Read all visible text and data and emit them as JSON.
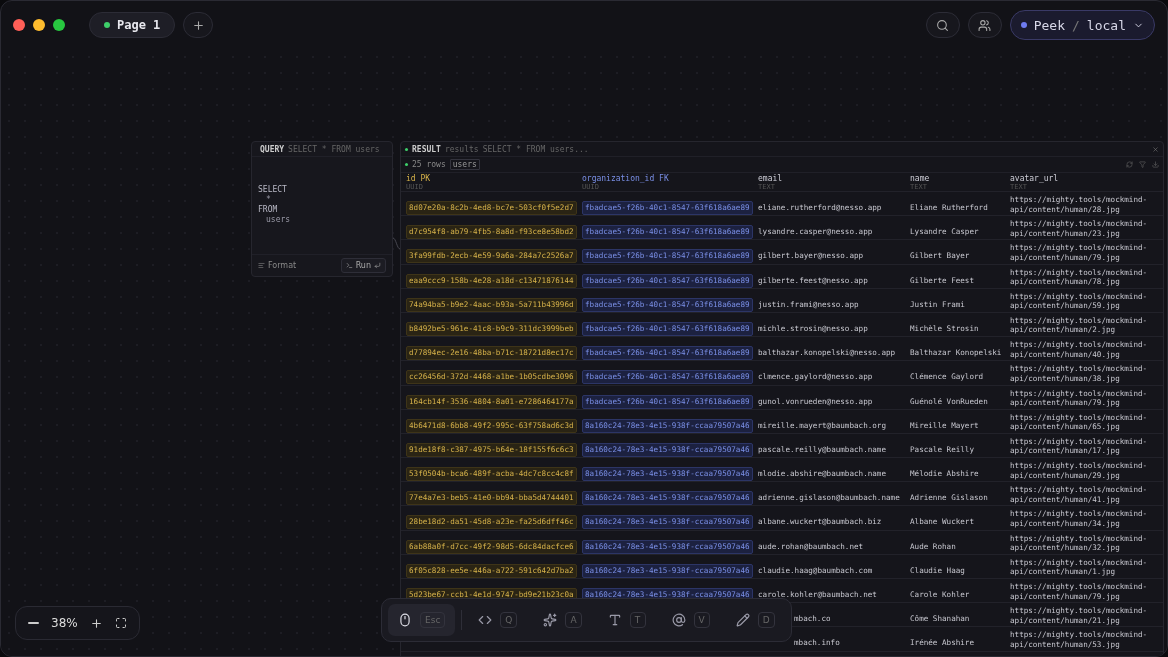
{
  "window": {
    "tabs": [
      {
        "label": "Page 1",
        "selected": true
      }
    ],
    "workspace": {
      "name": "Peek",
      "separator": "/",
      "env": "local"
    }
  },
  "query": {
    "title": "QUERY",
    "subtitle": "SELECT * FROM users",
    "sql": [
      {
        "kind": "keyword",
        "text": "SELECT"
      },
      {
        "kind": "value",
        "text": "*"
      },
      {
        "kind": "keyword",
        "text": "FROM"
      },
      {
        "kind": "value",
        "text": "users"
      }
    ],
    "format_label": "Format",
    "run_label": "Run"
  },
  "result": {
    "title": "RESULT",
    "source": "results",
    "query": "SELECT * FROM users...",
    "row_count": "25 rows",
    "table_tag": "users",
    "columns": [
      {
        "kind": "pk",
        "name": "id",
        "key": "PK",
        "type": "UUID"
      },
      {
        "kind": "fk",
        "name": "organization_id",
        "key": "FK",
        "type": "UUID"
      },
      {
        "kind": "text",
        "name": "email",
        "type": "TEXT"
      },
      {
        "kind": "text",
        "name": "name",
        "type": "TEXT"
      },
      {
        "kind": "text",
        "name": "avatar_url",
        "type": "TEXT"
      }
    ],
    "rows": [
      {
        "id": "8d07e20a-8c2b-4ed8-bc7e-503cf0f5e2d7",
        "organization_id": "fbadcae5-f26b-40c1-8547-63f618a6ae89",
        "email": "eliane.rutherford@nesso.app",
        "name": "Eliane Rutherford",
        "avatar_url": "https://mighty.tools/mockmind-api/content/human/28.jpg"
      },
      {
        "id": "d7c954f8-ab79-4fb5-8a8d-f93ce8e58bd2",
        "organization_id": "fbadcae5-f26b-40c1-8547-63f618a6ae89",
        "email": "lysandre.casper@nesso.app",
        "name": "Lysandre Casper",
        "avatar_url": "https://mighty.tools/mockmind-api/content/human/23.jpg"
      },
      {
        "id": "3fa99fdb-2ecb-4e59-9a6a-284a7c2526a7",
        "organization_id": "fbadcae5-f26b-40c1-8547-63f618a6ae89",
        "email": "gilbert.bayer@nesso.app",
        "name": "Gilbert Bayer",
        "avatar_url": "https://mighty.tools/mockmind-api/content/human/79.jpg"
      },
      {
        "id": "eaa9ccc9-158b-4e28-a18d-c13471876144",
        "organization_id": "fbadcae5-f26b-40c1-8547-63f618a6ae89",
        "email": "gilberte.feest@nesso.app",
        "name": "Gilberte Feest",
        "avatar_url": "https://mighty.tools/mockmind-api/content/human/78.jpg"
      },
      {
        "id": "74a94ba5-b9e2-4aac-b93a-5a711b43996d",
        "organization_id": "fbadcae5-f26b-40c1-8547-63f618a6ae89",
        "email": "justin.frami@nesso.app",
        "name": "Justin Frami",
        "avatar_url": "https://mighty.tools/mockmind-api/content/human/59.jpg"
      },
      {
        "id": "b8492be5-961e-41c8-b9c9-311dc3999beb",
        "organization_id": "fbadcae5-f26b-40c1-8547-63f618a6ae89",
        "email": "michle.strosin@nesso.app",
        "name": "Michèle Strosin",
        "avatar_url": "https://mighty.tools/mockmind-api/content/human/2.jpg"
      },
      {
        "id": "d77894ec-2e16-48ba-b71c-18721d8ec17c",
        "organization_id": "fbadcae5-f26b-40c1-8547-63f618a6ae89",
        "email": "balthazar.konopelski@nesso.app",
        "name": "Balthazar Konopelski",
        "avatar_url": "https://mighty.tools/mockmind-api/content/human/40.jpg"
      },
      {
        "id": "cc26456d-372d-4468-a1be-1b05cdbe3096",
        "organization_id": "fbadcae5-f26b-40c1-8547-63f618a6ae89",
        "email": "clmence.gaylord@nesso.app",
        "name": "Clémence Gaylord",
        "avatar_url": "https://mighty.tools/mockmind-api/content/human/38.jpg"
      },
      {
        "id": "164cb14f-3536-4804-8a01-e7286464177a",
        "organization_id": "fbadcae5-f26b-40c1-8547-63f618a6ae89",
        "email": "gunol.vonrueden@nesso.app",
        "name": "Guénolé VonRueden",
        "avatar_url": "https://mighty.tools/mockmind-api/content/human/79.jpg"
      },
      {
        "id": "4b6471d8-6bb8-49f2-995c-63f758ad6c3d",
        "organization_id": "8a160c24-78e3-4e15-938f-ccaa79507a46",
        "email": "mireille.mayert@baumbach.org",
        "name": "Mireille Mayert",
        "avatar_url": "https://mighty.tools/mockmind-api/content/human/65.jpg"
      },
      {
        "id": "91de18f8-c387-4975-b64e-18f155f6c6c3",
        "organization_id": "8a160c24-78e3-4e15-938f-ccaa79507a46",
        "email": "pascale.reilly@baumbach.name",
        "name": "Pascale Reilly",
        "avatar_url": "https://mighty.tools/mockmind-api/content/human/17.jpg"
      },
      {
        "id": "53f0504b-bca6-489f-acba-4dc7c8cc4c8f",
        "organization_id": "8a160c24-78e3-4e15-938f-ccaa79507a46",
        "email": "mlodie.abshire@baumbach.name",
        "name": "Mélodie Abshire",
        "avatar_url": "https://mighty.tools/mockmind-api/content/human/29.jpg"
      },
      {
        "id": "77e4a7e3-beb5-41e0-bb94-bba5d4744401",
        "organization_id": "8a160c24-78e3-4e15-938f-ccaa79507a46",
        "email": "adrienne.gislason@baumbach.name",
        "name": "Adrienne Gislason",
        "avatar_url": "https://mighty.tools/mockmind-api/content/human/41.jpg"
      },
      {
        "id": "28be18d2-da51-45d8-a23e-fa25d6dff46c",
        "organization_id": "8a160c24-78e3-4e15-938f-ccaa79507a46",
        "email": "albane.wuckert@baumbach.biz",
        "name": "Albane Wuckert",
        "avatar_url": "https://mighty.tools/mockmind-api/content/human/34.jpg"
      },
      {
        "id": "6ab88a0f-d7cc-49f2-98d5-6dc84dacfce6",
        "organization_id": "8a160c24-78e3-4e15-938f-ccaa79507a46",
        "email": "aude.rohan@baumbach.net",
        "name": "Aude Rohan",
        "avatar_url": "https://mighty.tools/mockmind-api/content/human/32.jpg"
      },
      {
        "id": "6f05c828-ee5e-446a-a722-591c642d7ba2",
        "organization_id": "8a160c24-78e3-4e15-938f-ccaa79507a46",
        "email": "claudie.haag@baumbach.com",
        "name": "Claudie Haag",
        "avatar_url": "https://mighty.tools/mockmind-api/content/human/1.jpg"
      },
      {
        "id": "5d23be67-ccb1-4e1d-9747-bd9e21b23c0a",
        "organization_id": "8a160c24-78e3-4e15-938f-ccaa79507a46",
        "email": "carole.kohler@baumbach.net",
        "name": "Carole Kohler",
        "avatar_url": "https://mighty.tools/mockmind-api/content/human/79.jpg"
      },
      {
        "email": "mbach.co",
        "name": "Côme Shanahan",
        "avatar_url": "https://mighty.tools/mockmind-api/content/human/21.jpg"
      },
      {
        "email": "mbach.info",
        "name": "Irénée Abshire",
        "avatar_url": "https://mighty.tools/mockmind-api/content/human/53.jpg"
      }
    ]
  },
  "zoom": {
    "value": "38%"
  },
  "toolbar": [
    {
      "kind": "select",
      "key": "Esc",
      "selected": true
    },
    {
      "kind": "code",
      "key": "Q",
      "selected": false
    },
    {
      "kind": "ai",
      "key": "A",
      "selected": false
    },
    {
      "kind": "text",
      "key": "T",
      "selected": false
    },
    {
      "kind": "mention",
      "key": "V",
      "selected": false
    },
    {
      "kind": "draw",
      "key": "D",
      "selected": false
    }
  ]
}
